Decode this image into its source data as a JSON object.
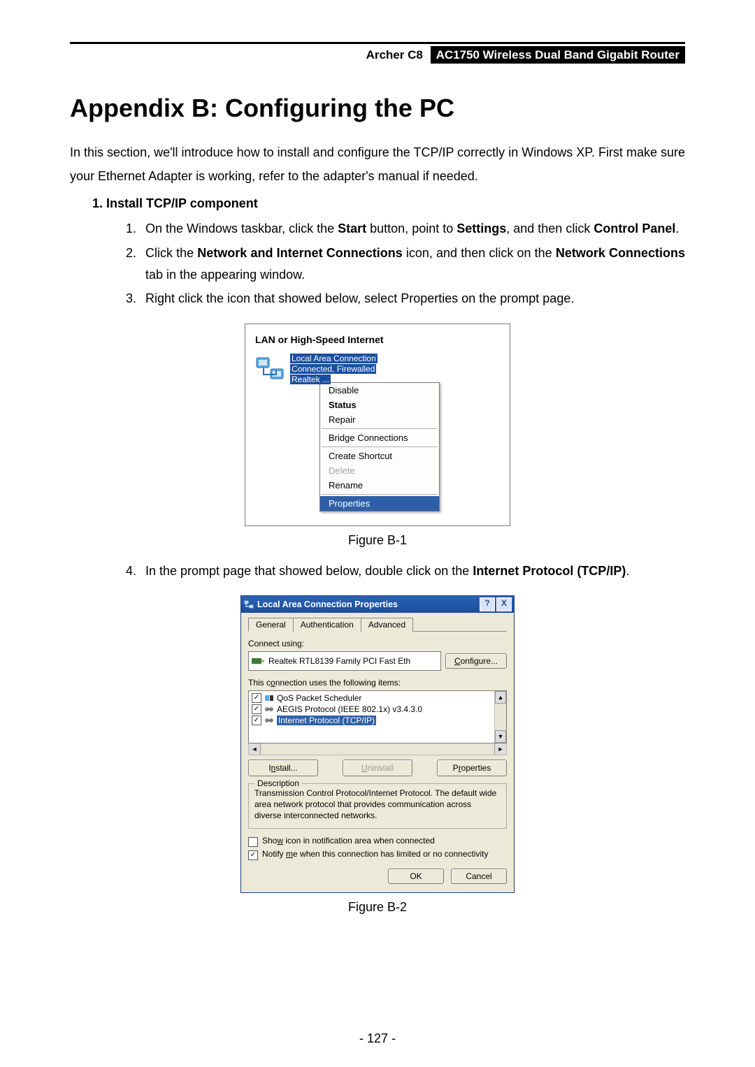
{
  "header": {
    "model": "Archer C8",
    "desc": "AC1750 Wireless Dual Band Gigabit Router"
  },
  "title": "Appendix B: Configuring the PC",
  "intro": "In this section, we'll introduce how to install and configure the TCP/IP correctly in Windows XP. First make sure your Ethernet Adapter is working, refer to the adapter's manual if needed.",
  "section1": {
    "number": "1.",
    "title": "Install TCP/IP component",
    "step1_a": "On the Windows taskbar, click the ",
    "step1_b": "Start",
    "step1_c": " button, point to ",
    "step1_d": "Settings",
    "step1_e": ", and then click ",
    "step1_f": "Control Panel",
    "step1_g": ".",
    "step2_a": "Click the ",
    "step2_b": "Network and Internet Connections",
    "step2_c": " icon, and then click on the ",
    "step2_d": "Network Connections",
    "step2_e": " tab in the appearing window.",
    "step3": "Right click the icon that showed below, select Properties on the prompt page.",
    "step4_a": "In the prompt page that showed below, double click on the ",
    "step4_b": "Internet Protocol (TCP/IP)",
    "step4_c": "."
  },
  "fig1": {
    "caption": "Figure B-1",
    "panel_title": "LAN or High-Speed Internet",
    "conn_name": "Local Area Connection",
    "conn_status": "Connected, Firewalled",
    "conn_adapter": "Realtek ...",
    "menu": {
      "disable": "Disable",
      "status": "Status",
      "repair": "Repair",
      "bridge": "Bridge Connections",
      "shortcut": "Create Shortcut",
      "delete": "Delete",
      "rename": "Rename",
      "properties": "Properties"
    }
  },
  "fig2": {
    "caption": "Figure B-2",
    "title": "Local Area Connection   Properties",
    "help": "?",
    "close": "X",
    "tabs": {
      "general": "General",
      "auth": "Authentication",
      "adv": "Advanced"
    },
    "connect_using": "Connect using:",
    "adapter": "Realtek RTL8139 Family PCI Fast Eth",
    "configure": "Configure...",
    "uses_items": "This connection uses the following items:",
    "items": {
      "qos": "QoS Packet Scheduler",
      "aegis": "AEGIS Protocol (IEEE 802.1x) v3.4.3.0",
      "tcpip": "Internet Protocol (TCP/IP)"
    },
    "btn_install": "Install...",
    "btn_uninstall": "Uninstall",
    "btn_properties": "Properties",
    "desc_label": "Description",
    "desc_text": "Transmission Control Protocol/Internet Protocol. The default wide area network protocol that provides communication across diverse interconnected networks.",
    "chk_show": "Show icon in notification area when connected",
    "chk_notify": "Notify me when this connection has limited or no connectivity",
    "ok": "OK",
    "cancel": "Cancel"
  },
  "page_number": "- 127 -"
}
